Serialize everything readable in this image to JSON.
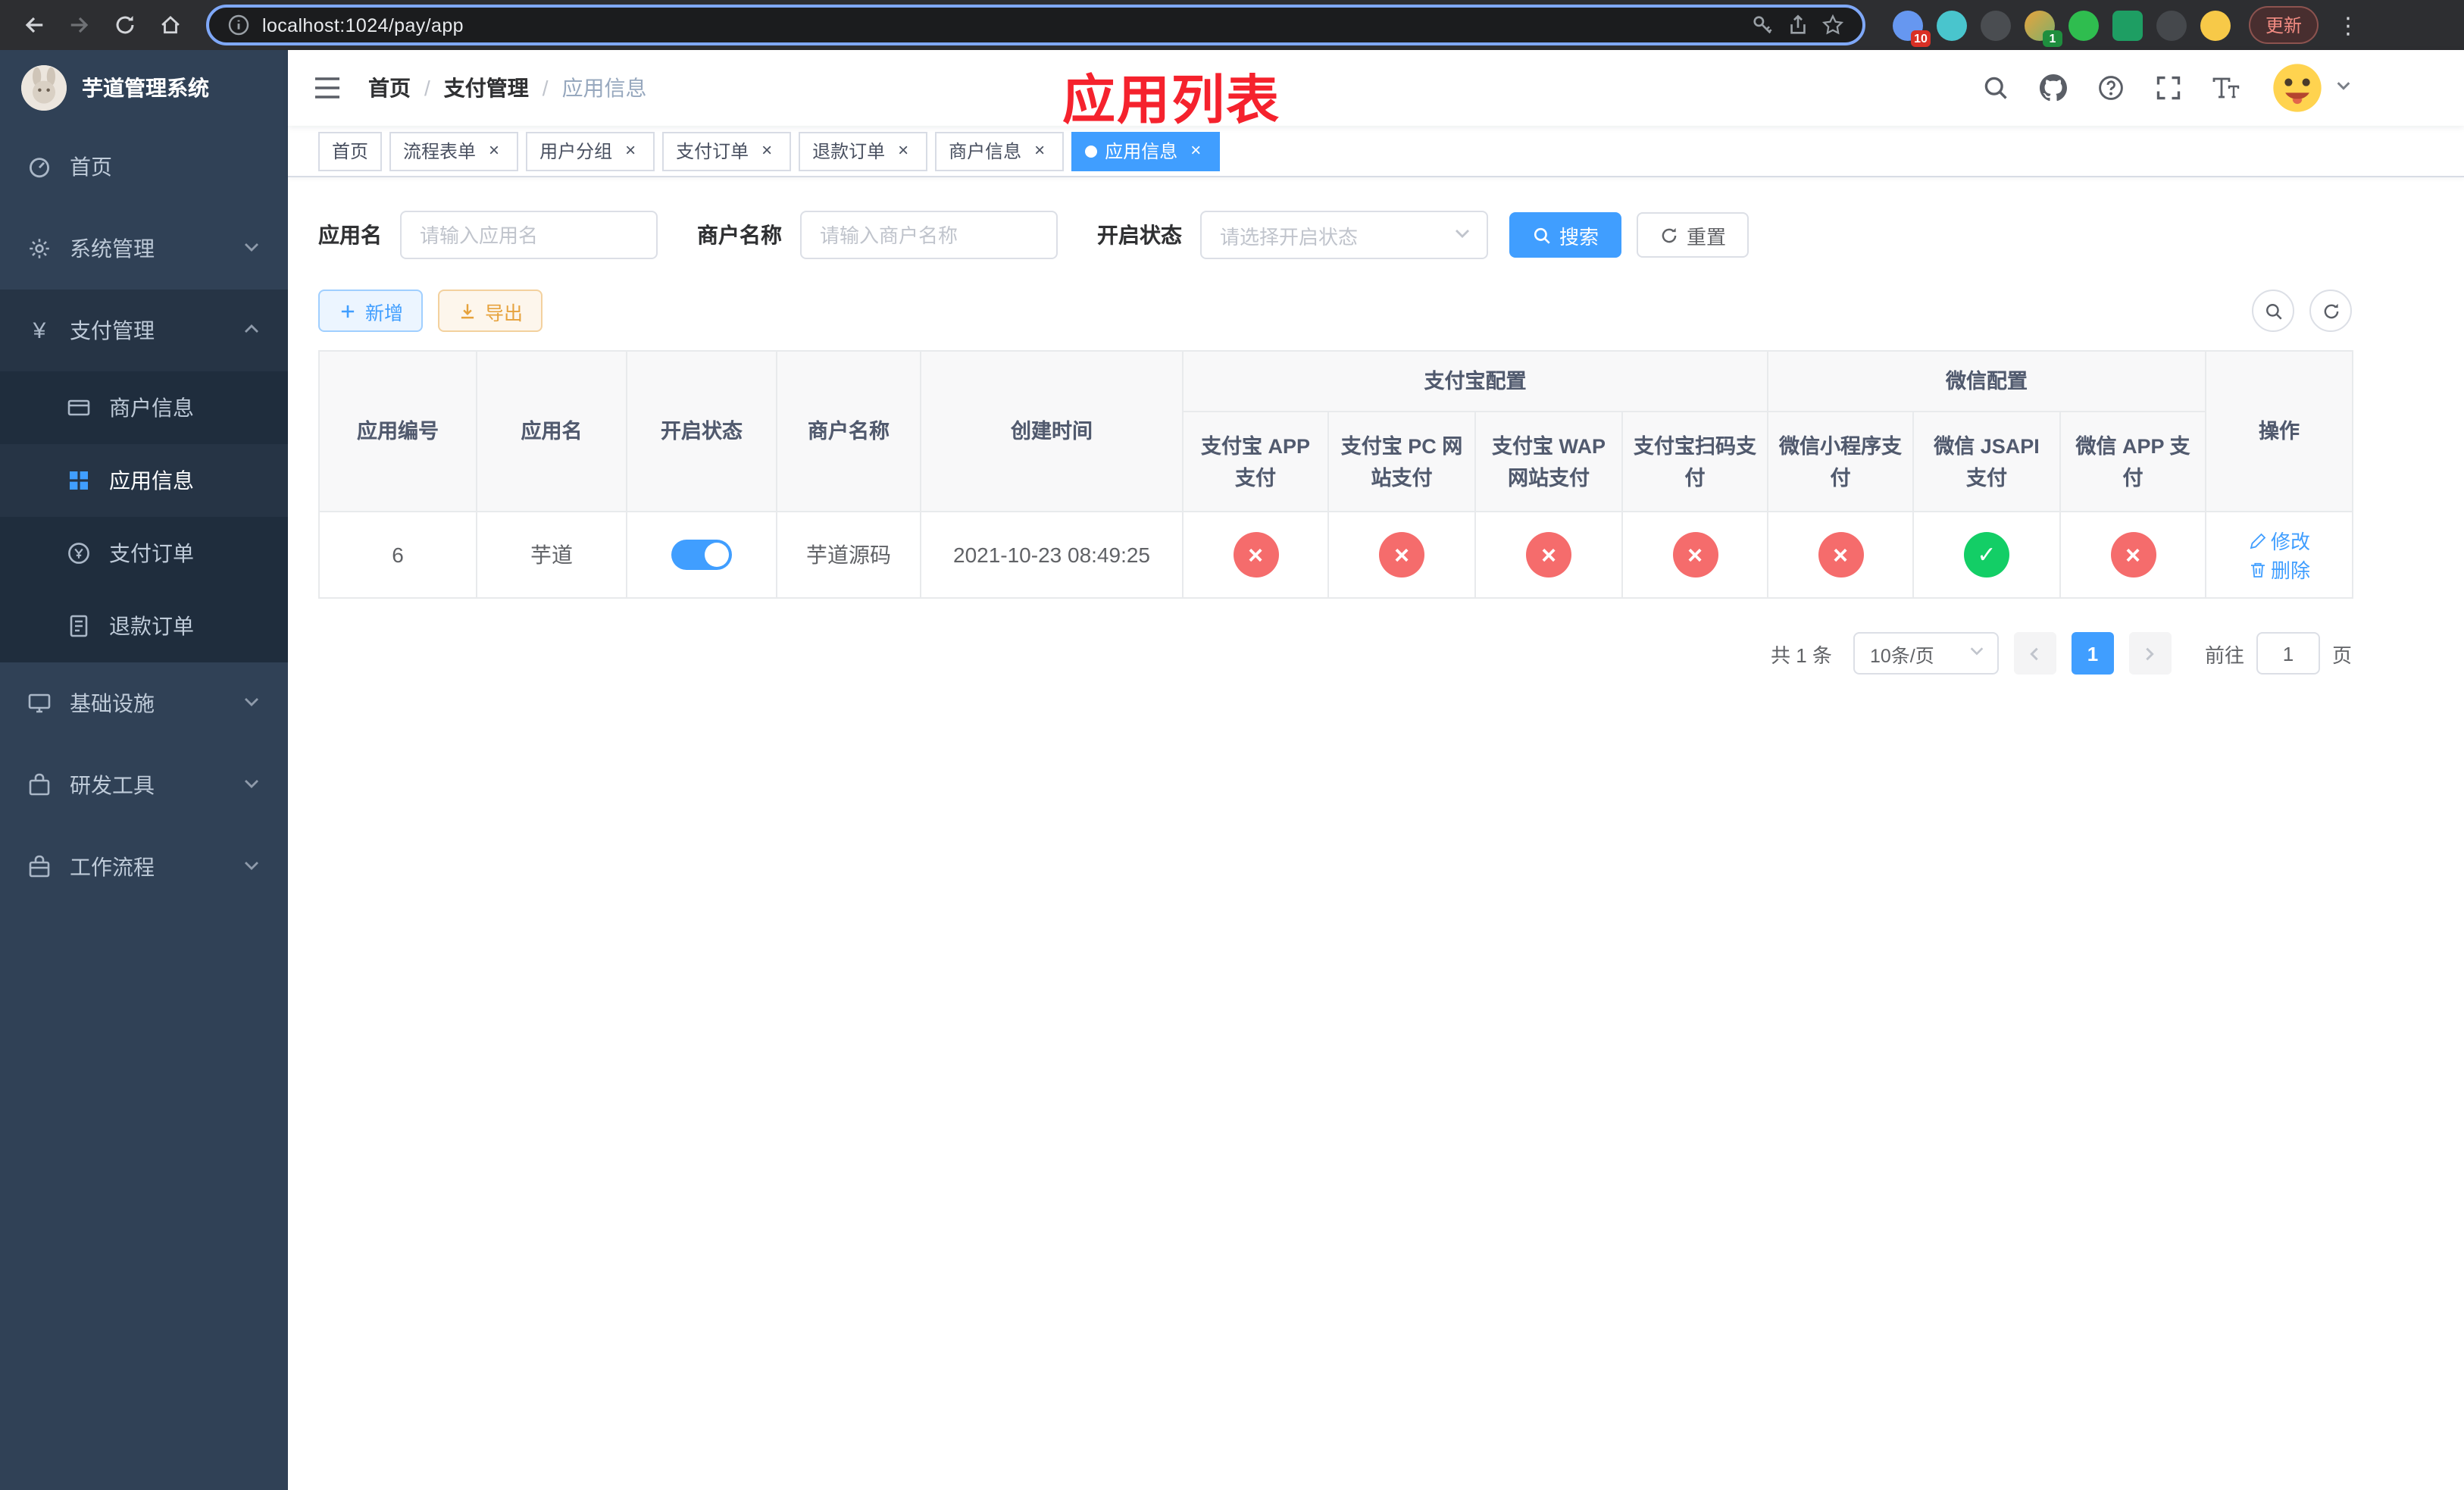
{
  "colors": {
    "primary": "#409eff",
    "success": "#13ce66",
    "danger": "#f56c6c",
    "warning": "#e6a23c",
    "sidebar_bg": "#304156",
    "submenu_bg": "#1f2d3d",
    "annotation_red": "#f5222d"
  },
  "browser": {
    "url": "localhost:1024/pay/app",
    "update_button": "更新",
    "ext_badge_puzzle": "10",
    "ext_badge_avatar": "1"
  },
  "sidebar": {
    "title": "芋道管理系统",
    "menu": [
      {
        "label": "首页"
      },
      {
        "label": "系统管理"
      },
      {
        "label": "支付管理"
      },
      {
        "label": "基础设施"
      },
      {
        "label": "研发工具"
      },
      {
        "label": "工作流程"
      }
    ],
    "pay_children": [
      {
        "label": "商户信息"
      },
      {
        "label": "应用信息"
      },
      {
        "label": "支付订单"
      },
      {
        "label": "退款订单"
      }
    ]
  },
  "navbar": {
    "breadcrumb": [
      "首页",
      "支付管理",
      "应用信息"
    ]
  },
  "annotation": "应用列表",
  "tags": [
    {
      "label": "首页"
    },
    {
      "label": "流程表单"
    },
    {
      "label": "用户分组"
    },
    {
      "label": "支付订单"
    },
    {
      "label": "退款订单"
    },
    {
      "label": "商户信息"
    },
    {
      "label": "应用信息"
    }
  ],
  "filters": {
    "app_name": {
      "label": "应用名",
      "placeholder": "请输入应用名"
    },
    "merchant_name": {
      "label": "商户名称",
      "placeholder": "请输入商户名称"
    },
    "status": {
      "label": "开启状态",
      "placeholder": "请选择开启状态"
    },
    "search": "搜索",
    "reset": "重置"
  },
  "toolbar": {
    "add": "新增",
    "export": "导出"
  },
  "table": {
    "headers": {
      "app_id": "应用编号",
      "app_name": "应用名",
      "status": "开启状态",
      "merchant": "商户名称",
      "created": "创建时间",
      "alipay_group": "支付宝配置",
      "wechat_group": "微信配置",
      "alipay_app": "支付宝 APP 支付",
      "alipay_pc": "支付宝 PC 网站支付",
      "alipay_wap": "支付宝 WAP 网站支付",
      "alipay_qr": "支付宝扫码支付",
      "wx_lite": "微信小程序支付",
      "wx_jsapi": "微信 JSAPI 支付",
      "wx_app": "微信 APP 支付",
      "actions": "操作"
    },
    "rows": [
      {
        "app_id": "6",
        "app_name": "芋道",
        "enabled": true,
        "merchant": "芋道源码",
        "created": "2021-10-23 08:49:25",
        "configs": {
          "alipay_app": false,
          "alipay_pc": false,
          "alipay_wap": false,
          "alipay_qr": false,
          "wx_lite": false,
          "wx_jsapi": true,
          "wx_app": false
        },
        "actions": {
          "edit": "修改",
          "delete": "删除"
        }
      }
    ]
  },
  "pagination": {
    "total": "共 1 条",
    "page_size": "10条/页",
    "current": "1",
    "goto": "前往",
    "goto_value": "1",
    "unit": "页"
  }
}
